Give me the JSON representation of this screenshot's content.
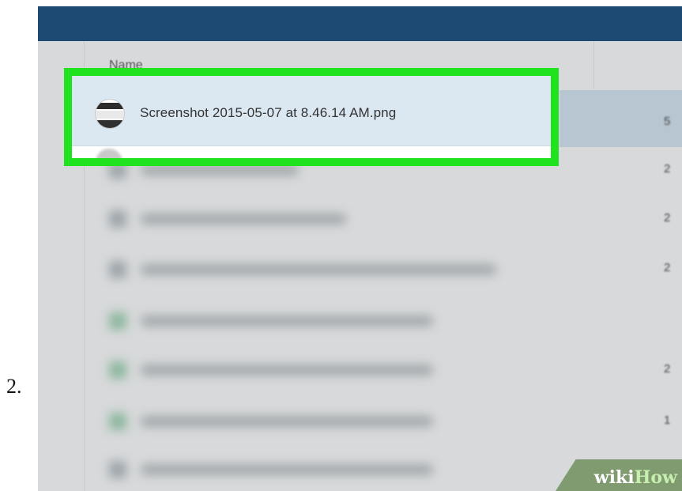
{
  "step": {
    "number": "2."
  },
  "file_list": {
    "column_header": "Name",
    "selected_file": {
      "name": "Screenshot 2015-05-07 at 8.46.14 AM.png",
      "size_partial": "5"
    },
    "size_partials": [
      "2",
      "2",
      "2",
      "2",
      "1"
    ]
  },
  "watermark": {
    "part1": "wiki",
    "part2": "How"
  },
  "colors": {
    "topbar": "#1d4a73",
    "highlight_border": "#20e21f",
    "selected_row": "#dbe8f1"
  },
  "icons": {
    "file_thumbnail": "image-thumbnail-icon"
  }
}
